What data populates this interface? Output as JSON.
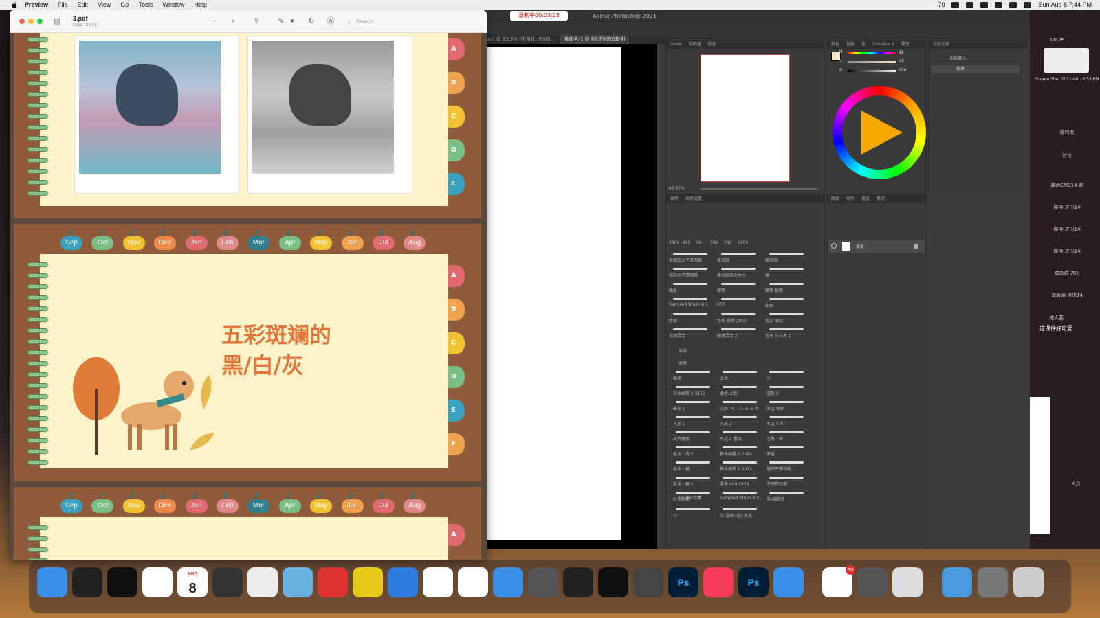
{
  "menubar": {
    "app": "Preview",
    "items": [
      "File",
      "Edit",
      "View",
      "Go",
      "Tools",
      "Window",
      "Help"
    ],
    "battery": "70",
    "clock": "Sun Aug 8  7:44 PM"
  },
  "preview": {
    "title": "3.pdf",
    "subtitle": "Page 10 of 17",
    "search_placeholder": "Search",
    "months": [
      "Sep",
      "Oct",
      "Nov",
      "Dec",
      "Jan",
      "Feb",
      "Mar",
      "Apr",
      "May",
      "Jun",
      "Jul",
      "Aug"
    ],
    "month_colors": [
      "#3aa2c0",
      "#7cbf86",
      "#f2c232",
      "#ee8a4a",
      "#e06a70",
      "#e08a8a",
      "#2f7f8e",
      "#7cbf86",
      "#f2c232",
      "#f0a24e",
      "#e06a70",
      "#e08a8a"
    ],
    "tabs_right": [
      "A",
      "B",
      "C",
      "D",
      "E",
      "F"
    ],
    "tab_colors": [
      "#e06a70",
      "#f0a24e",
      "#f2c232",
      "#7cbf86",
      "#3aa2c0",
      "#f0a24e"
    ],
    "slide_title_line1": "五彩斑斓的",
    "slide_title_line2": "黑/白/灰"
  },
  "photoshop": {
    "recording": "录制中00:03:25",
    "app_name": "Adobe Photoshop 2021",
    "doc_tabs": [
      "1.psd @ 33.3% (阳角社, RGB/...",
      "未命名-1 @ 66.7%(RGB/8)"
    ],
    "zoom": "66.67%",
    "panel_tabs_nav": [
      "Orme",
      "导航器",
      "信息"
    ],
    "panel_tabs_color": [
      "颜色",
      "色板",
      "库",
      "Coolorus 2",
      "属性"
    ],
    "panel_tabs_history": [
      "历史记录"
    ],
    "history_items": [
      "未标题-1",
      "新建"
    ],
    "panel_tabs_brush": [
      "画笔",
      "画笔设置"
    ],
    "panel_tabs_layers": [
      "图层",
      "动作",
      "通道",
      "路径"
    ],
    "layer_name": "背景",
    "brush_values": [
      "3466",
      "421",
      "66",
      "186",
      "500",
      "1466"
    ],
    "brush_names": [
      "依据压力不透明度",
      "柔边圆",
      "硬边圆",
      "按压力不透明度",
      "柔边圆压力大小",
      "硬",
      "橡皮",
      "硬笔",
      "硬笔 铅笔",
      "Sampled Brush 6 1",
      "000",
      "仙水",
      "纹理",
      "色块 质感 2020",
      "水边 硬边",
      "自动混合",
      "随意混合 2",
      "色块 小三角 2"
    ],
    "groups": [
      "勾线",
      "纹理",
      "12 涂抹合集"
    ],
    "brush_names2": [
      "橡皮",
      "上色",
      "小",
      "样本画笔 1 3151",
      "混色-上色",
      "混色 2",
      "晕染 2",
      "(c)R. M. - G. 5. 5 特",
      "水边 笔刷",
      "人皮 1",
      "人皮 2",
      "水边 4 A",
      "正片叠底",
      "水边 2 叠加",
      "毛发 - 丝",
      "毛发 - 洗 2",
      "样本画笔 1 2924",
      "禾毛",
      "毛发 - 硬",
      "样本画笔 1 2913",
      "植物平面勾线",
      "毛发 - 硬 2",
      "柔角 409 2923",
      "牛仔布纹理",
      "纱布纹理",
      "Sampled Brush 4 3...",
      "勾-细腻顶",
      "小",
      "勾-湿画 (冷)-水流"
    ],
    "color_values": [
      "42",
      "15",
      "100"
    ],
    "color_labels": [
      "H",
      "S",
      "B"
    ]
  },
  "rightstrip": {
    "top_label": "LaCie",
    "screenshot_label": "Screen Shot 2021-08...6.53 PM",
    "chat_items": [
      "资料库",
      "讨论",
      "暴晒CM214 退",
      "摇摆 进出14",
      "摇摆 进出14",
      "摇摆 进出14",
      "稿岛弥 进出",
      "沈清澜 退出14"
    ],
    "name": "咸大菌",
    "note": "这课件好可爱",
    "date": "6月"
  },
  "dock": {
    "calendar_month": "AUG",
    "calendar_day": "8",
    "ps1": "Ps",
    "ps2": "Ps",
    "badge": "70"
  }
}
